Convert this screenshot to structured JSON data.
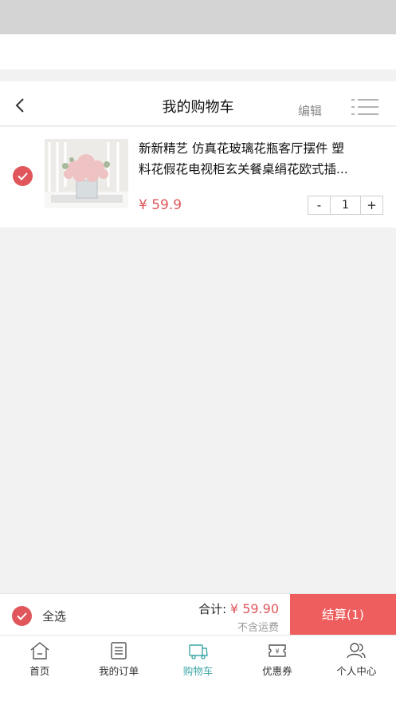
{
  "header": {
    "title": "我的购物车",
    "edit_label": "编辑",
    "back_icon": "chevron-left-icon",
    "menu_icon": "list-icon"
  },
  "cart": {
    "items": [
      {
        "title_line1": "新新精艺 仿真花玻璃花瓶客厅摆件 塑",
        "title_line2": "料花假花电视柜玄关餐桌绢花欧式插...",
        "price": "¥ 59.9",
        "quantity": "1",
        "selected": true
      }
    ],
    "decrement_label": "-",
    "increment_label": "+"
  },
  "checkout": {
    "select_all_label": "全选",
    "total_label": "合计:",
    "total_amount": "¥ 59.90",
    "shipping_note": "不含运费",
    "checkout_label": "结算(1)"
  },
  "tabs": [
    {
      "label": "首页",
      "icon": "home-icon",
      "active": false
    },
    {
      "label": "我的订单",
      "icon": "order-icon",
      "active": false
    },
    {
      "label": "购物车",
      "icon": "cart-icon",
      "active": true
    },
    {
      "label": "优惠券",
      "icon": "coupon-icon",
      "active": false
    },
    {
      "label": "个人中心",
      "icon": "user-icon",
      "active": false
    }
  ],
  "colors": {
    "accent_red": "#e0565b",
    "checkout_button": "#ef5e5e",
    "active_tab": "#3fa7a7"
  }
}
